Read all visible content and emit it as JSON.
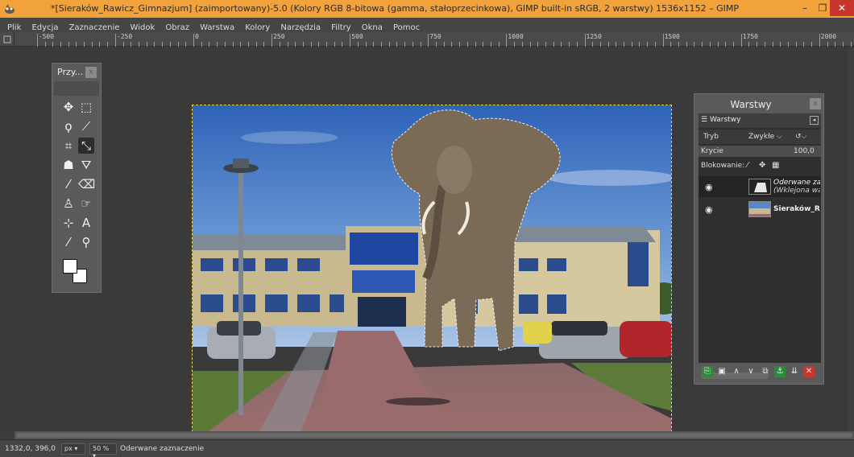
{
  "window": {
    "title": "*[Sieraków_Rawicz_Gimnazjum] (zaimportowany)-5.0 (Kolory RGB 8-bitowa (gamma, stałoprzecinkowa), GIMP built-in sRGB, 2 warstwy) 1536x1152 – GIMP",
    "minimize": "–",
    "maximize": "❐",
    "close": "✕"
  },
  "menu": [
    "Plik",
    "Edycja",
    "Zaznaczenie",
    "Widok",
    "Obraz",
    "Warstwa",
    "Kolory",
    "Narzędzia",
    "Filtry",
    "Okna",
    "Pomoc"
  ],
  "ruler": {
    "top_labels": [
      "-500",
      "-250",
      "0",
      "250",
      "500",
      "750",
      "1000",
      "1250",
      "1500",
      "1750",
      "2000"
    ],
    "left_labels": [
      "0",
      "250",
      "500",
      "750",
      "1000"
    ]
  },
  "toolbox": {
    "title": "Przy...",
    "close": "x"
  },
  "layers_panel": {
    "title": "Warstwy",
    "close": "x",
    "tab": "Warstwy",
    "mode_label": "Tryb",
    "mode_value": "Zwykłe",
    "opacity_label": "Krycie",
    "opacity_value": "100,0",
    "lock_label": "Blokowanie:",
    "layers": [
      {
        "name": "Oderwane zaz",
        "subname": "(Wklejona war"
      },
      {
        "name": "Sieraków_Ra"
      }
    ]
  },
  "statusbar": {
    "coords": "1332,0, 396,0",
    "unit": "px",
    "zoom": "50 %",
    "message": "Oderwane zaznaczenie"
  },
  "colors": {
    "titlebar": "#f2a23a",
    "close_button": "#c7352b",
    "panel_bg": "#5a5a5a",
    "selection_marquee": "#e6e04a"
  }
}
